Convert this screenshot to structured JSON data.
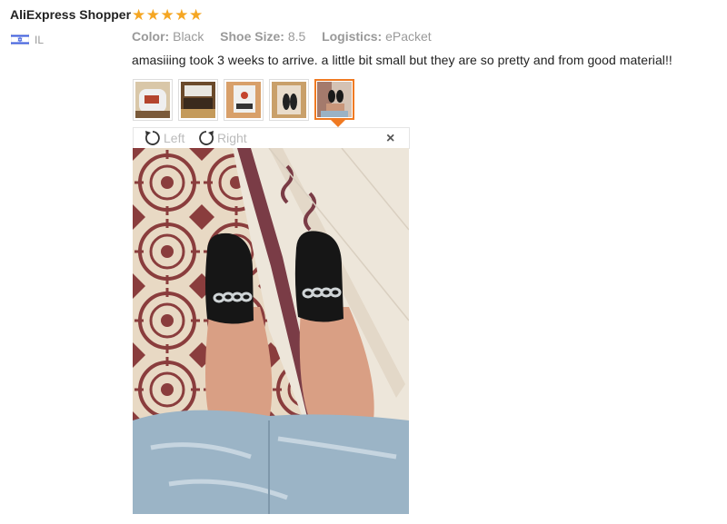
{
  "review": {
    "reviewer": "AliExpress Shopper",
    "stars": "★★★★★",
    "rating": 5,
    "country": "IL",
    "attributes": [
      {
        "key": "Color:",
        "value": "Black"
      },
      {
        "key": "Shoe Size:",
        "value": "8.5"
      },
      {
        "key": "Logistics:",
        "value": "ePacket"
      }
    ],
    "text": "amasiiing took 3 weeks to arrive. a little bit small but they are so pretty and from good material!!"
  },
  "viewer": {
    "rotate_left_label": "Left",
    "rotate_right_label": "Right",
    "close_label": "×",
    "active_thumbnail_index": 4
  },
  "colors": {
    "accent": "#f07a22",
    "star": "#f5a623",
    "muted": "#9a9a9a"
  },
  "icons": [
    "israel-flag-icon",
    "rotate-left-icon",
    "rotate-right-icon",
    "close-icon"
  ]
}
